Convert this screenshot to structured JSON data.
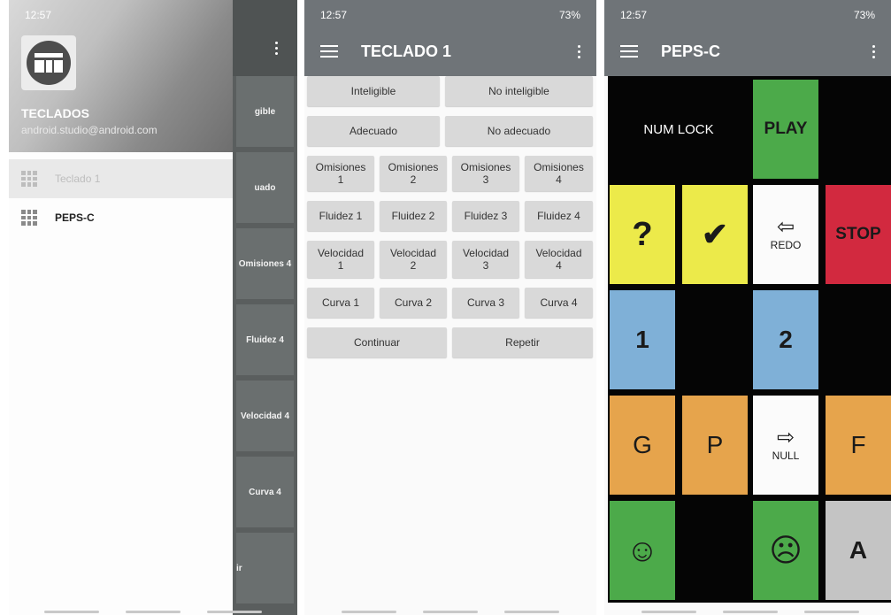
{
  "status_bar": {
    "time": "12:57",
    "battery": "73%"
  },
  "drawer": {
    "title": "TECLADOS",
    "account": "android.studio@android.com",
    "items": [
      {
        "label": "Teclado 1"
      },
      {
        "label": "PEPS-C"
      }
    ],
    "behind_labels": [
      "gible",
      "uado",
      "Omisiones 4",
      "Fluidez 4",
      "Velocidad 4",
      "Curva 4",
      "ir"
    ]
  },
  "teclado": {
    "title": "TECLADO 1",
    "row1": [
      "Inteligible",
      "No inteligible"
    ],
    "row2": [
      "Adecuado",
      "No adecuado"
    ],
    "omisiones": [
      "Omisiones 1",
      "Omisiones 2",
      "Omisiones 3",
      "Omisiones 4"
    ],
    "fluidez": [
      "Fluidez 1",
      "Fluidez 2",
      "Fluidez 3",
      "Fluidez 4"
    ],
    "velocidad": [
      "Velocidad 1",
      "Velocidad 2",
      "Velocidad 3",
      "Velocidad 4"
    ],
    "curva": [
      "Curva 1",
      "Curva 2",
      "Curva 3",
      "Curva 4"
    ],
    "actions": [
      "Continuar",
      "Repetir"
    ]
  },
  "peps": {
    "title": "PEPS-C",
    "num_lock": "NUM LOCK",
    "play": "PLAY",
    "question": "?",
    "check": "✔",
    "redo": "REDO",
    "stop": "STOP",
    "one": "1",
    "two": "2",
    "g": "G",
    "p": "P",
    "null": "NULL",
    "f": "F",
    "happy": "☺",
    "sad": "☹",
    "a": "A",
    "arrow_left": "⇦",
    "arrow_right": "⇨"
  },
  "colors": {
    "yellow": "#ecea4a",
    "blue": "#7fb0d7",
    "orange": "#e6a44c",
    "green": "#4caa4a",
    "red": "#d2293f",
    "toolbar": "#6f7478"
  }
}
